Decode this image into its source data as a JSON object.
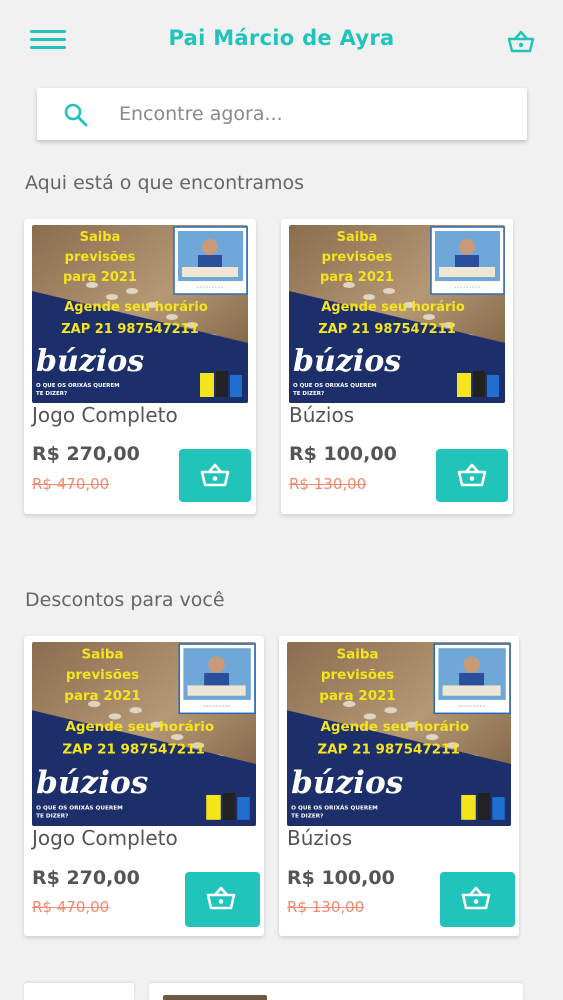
{
  "header": {
    "title": "Pai Márcio de Ayra",
    "menu_icon": "hamburger-menu-icon",
    "cart_icon": "shopping-basket-icon"
  },
  "search": {
    "placeholder": "Encontre agora...",
    "value": "",
    "icon": "search-icon"
  },
  "sections": [
    {
      "title": "Aqui está o que encontramos",
      "products": [
        {
          "name": "Jogo Completo",
          "price": "R$ 270,00",
          "old_price": "R$ 470,00"
        },
        {
          "name": "Búzios",
          "price": "R$ 100,00",
          "old_price": "R$ 130,00"
        }
      ]
    },
    {
      "title": "Descontos para você",
      "products": [
        {
          "name": "Jogo Completo",
          "price": "R$ 270,00",
          "old_price": "R$ 470,00"
        },
        {
          "name": "Búzios",
          "price": "R$ 100,00",
          "old_price": "R$ 130,00"
        }
      ]
    }
  ],
  "banner": {
    "line1": "Saiba",
    "line2": "previsões",
    "line3": "para 2021",
    "line4": "Agende seu horário",
    "line5": "ZAP 21 987547211",
    "brand": "búzios",
    "tagline1": "O QUE OS ORIXÁS QUEREM",
    "tagline2": "TE DIZER?"
  },
  "colors": {
    "accent": "#21c4ba",
    "old_price": "#f08a6f",
    "banner_navy": "#1d2f6b",
    "banner_yellow": "#f4e51c"
  }
}
